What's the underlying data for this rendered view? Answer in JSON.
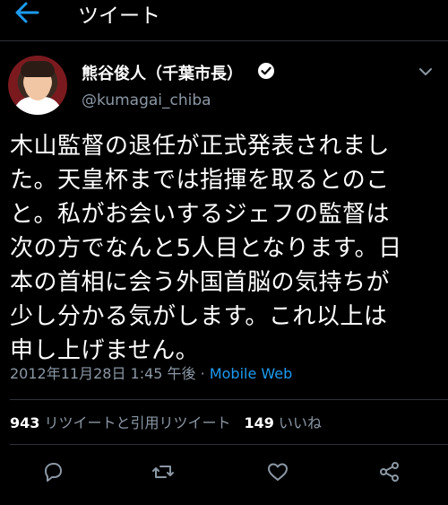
{
  "header": {
    "title": "ツイート"
  },
  "user": {
    "name": "熊谷俊人（千葉市長）",
    "handle": "@kumagai_chiba"
  },
  "tweet": {
    "lines": [
      "木山監督の退任が正式発表されまし",
      "た。天皇杯までは指揮を取るとのこ",
      "と。私がお会いするジェフの監督は",
      "次の方でなんと5人目となります。日",
      "本の首相に会う外国首脳の気持ちが",
      "少し分かる気がします。これ以上は",
      "申し上げません。"
    ],
    "timestamp": "2012年11月28日 1:45 午後",
    "separator": " · ",
    "source": "Mobile Web"
  },
  "stats": {
    "retweets": "943",
    "retweets_label": "リツイートと引用リツイート",
    "likes": "149",
    "likes_label": "いいね"
  },
  "colors": {
    "accent": "#1d9bf0",
    "muted": "#8b98a5",
    "background": "#000000"
  },
  "icons": [
    "back-arrow-icon",
    "verified-icon",
    "chevron-down-icon",
    "reply-icon",
    "retweet-icon",
    "like-icon",
    "share-icon"
  ]
}
